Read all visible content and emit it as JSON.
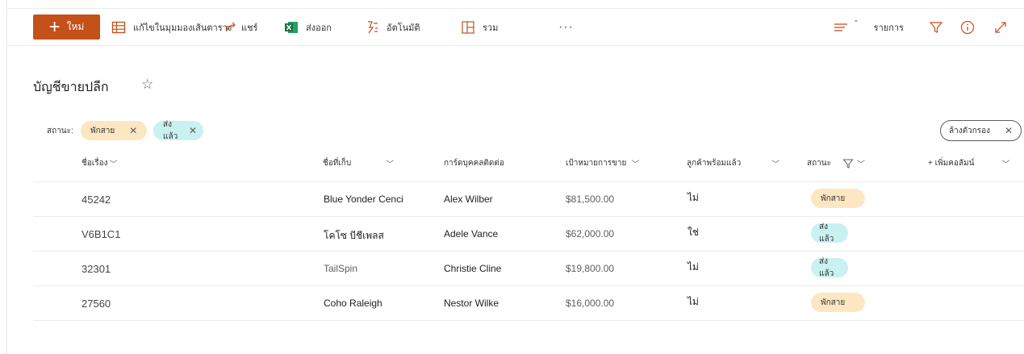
{
  "toolbar": {
    "new_label": "ใหม่",
    "grid_edit_label": "แก้ไขในมุมมองเส้นตาราง",
    "share_label": "แชร์",
    "export_label": "ส่งออก",
    "automate_label": "อัตโนมัติ",
    "integrate_label": "รวม",
    "more_label": "···",
    "view_label": "รายการ",
    "view_caret": "ˇ"
  },
  "list": {
    "title": "บัญชีขายปลีก",
    "star": "☆"
  },
  "filters": {
    "label": "สถานะ:",
    "chips": [
      "พักสาย",
      "ส่งแล้ว"
    ],
    "clear_label": "ล้างตัวกรอง",
    "close_glyph": "✕"
  },
  "columns": {
    "title": "ชื่อเรื่อง",
    "company": "ชื่อที่เก็บ",
    "contact": "การ์ดบุคคลติดต่อ",
    "target": "เป้าหมายการขาย",
    "ready": "ลูกค้าพร้อมแล้ว",
    "status": "สถานะ",
    "add_column": "+ เพิ่มคอลัมน์"
  },
  "rows": [
    {
      "title": "45242",
      "company": "Blue Yonder Cenci",
      "contact": "Alex Wilber",
      "target": "$81,500.00",
      "ready": "ไม่",
      "status": "พักสาย"
    },
    {
      "title": "V6B1C1",
      "company": "โคโซ บีชีเพลส",
      "contact": "Adele Vance",
      "target": "$62,000.00",
      "ready": "ใช่",
      "status": "ส่งแล้ว"
    },
    {
      "title": "32301",
      "company": "TailSpin",
      "contact": "Christie Cline",
      "target": "$19,800.00",
      "ready": "ไม่",
      "status": "ส่งแล้ว"
    },
    {
      "title": "27560",
      "company": "Coho Raleigh",
      "contact": "Nestor Wilke",
      "target": "$16,000.00",
      "ready": "ไม่",
      "status": "พักสาย"
    }
  ],
  "colors": {
    "brand": "#c4501a",
    "pending": "#fde7c3",
    "sent": "#c9f1f2",
    "excel_green": "#1d6f42"
  }
}
